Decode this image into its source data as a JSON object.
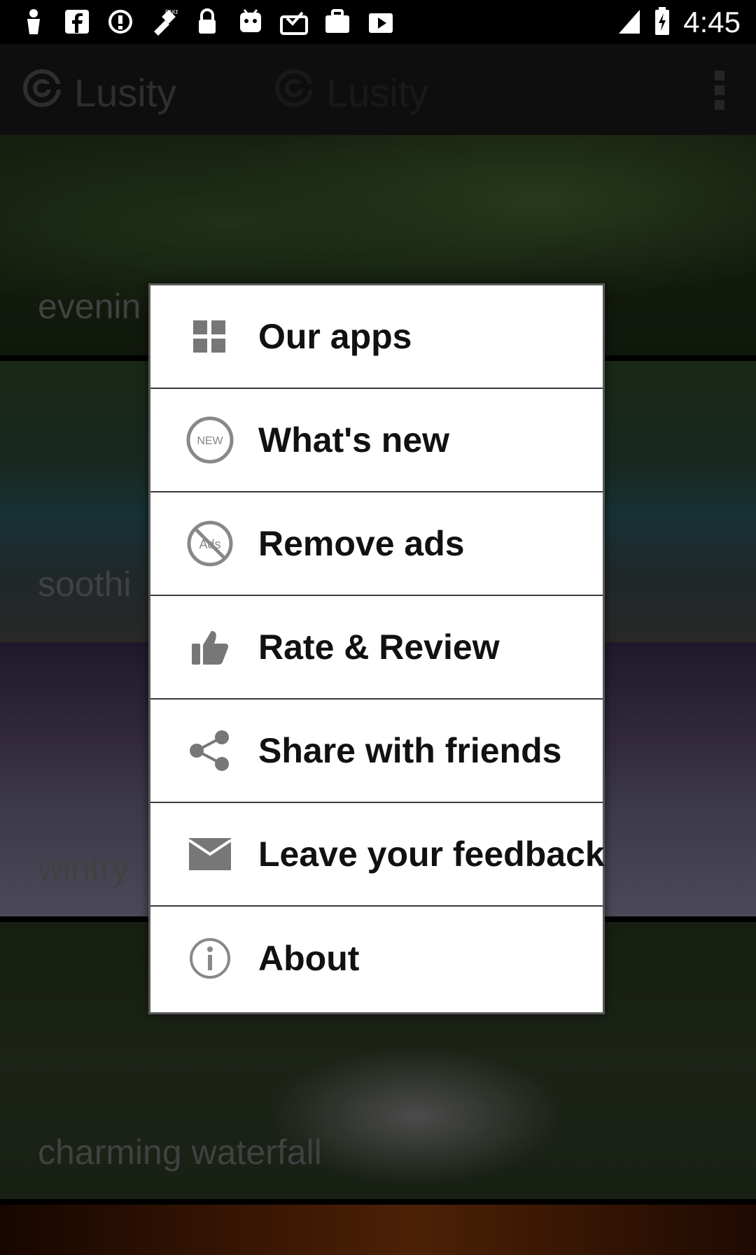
{
  "status_bar": {
    "time": "4:45",
    "icons": [
      "app-notification-icon",
      "facebook-icon",
      "data-saver-icon",
      "fake-gps-icon",
      "lock-icon",
      "android-icon",
      "inbox-icon",
      "briefcase-icon",
      "play-store-icon"
    ]
  },
  "app_bar": {
    "title": "Lusity",
    "title_secondary": "Lusity"
  },
  "cards": [
    {
      "caption": "evenin"
    },
    {
      "caption": "soothi"
    },
    {
      "caption": "wintry"
    },
    {
      "caption": "charming waterfall"
    }
  ],
  "menu": {
    "items": [
      {
        "label": "Our apps",
        "icon": "grid-apps-icon"
      },
      {
        "label": "What's new",
        "icon": "new-badge-icon",
        "icon_text": "NEW"
      },
      {
        "label": "Remove ads",
        "icon": "no-ads-icon",
        "icon_text": "Ads"
      },
      {
        "label": "Rate & Review",
        "icon": "thumbs-up-icon"
      },
      {
        "label": "Share with friends",
        "icon": "share-icon"
      },
      {
        "label": "Leave your feedback",
        "icon": "mail-icon"
      },
      {
        "label": "About",
        "icon": "info-icon"
      }
    ]
  },
  "colors": {
    "menu_bg": "#ffffff",
    "menu_text": "#111111",
    "icon_gray": "#888888"
  }
}
